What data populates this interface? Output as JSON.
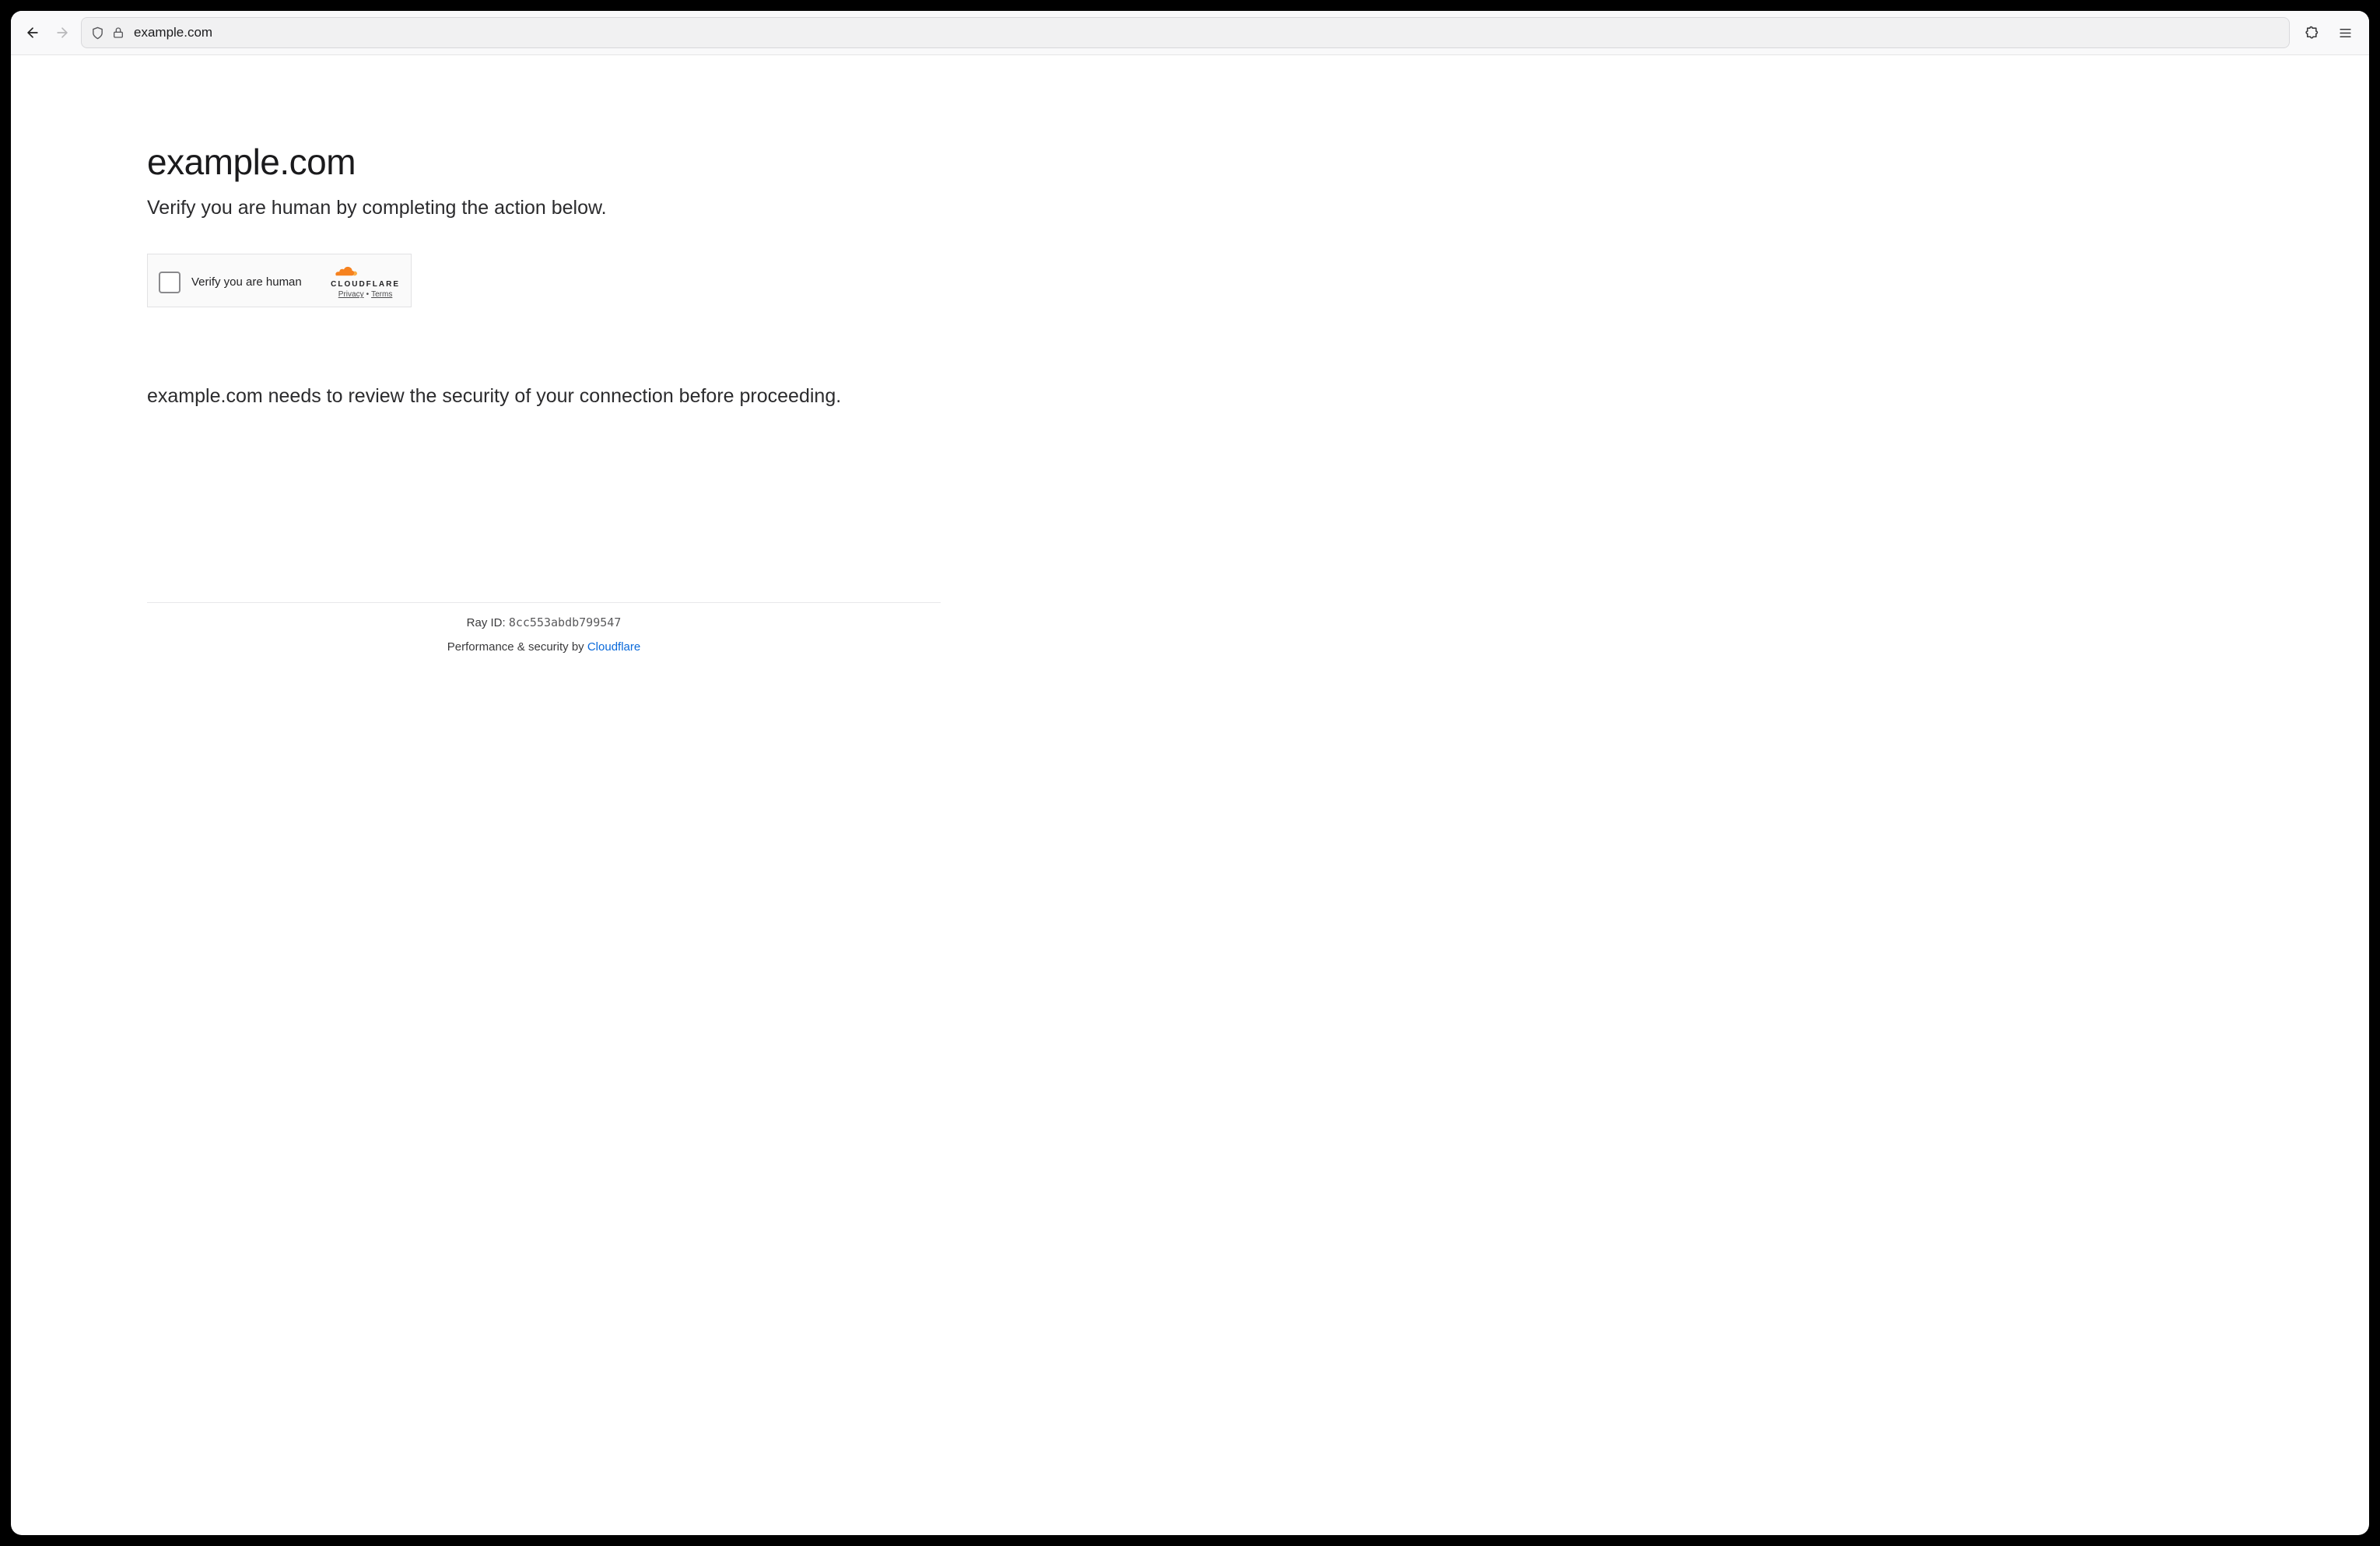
{
  "browser": {
    "url": "example.com"
  },
  "page": {
    "site_title": "example.com",
    "subtitle": "Verify you are human by completing the action below.",
    "message": "example.com needs to review the security of your connection before proceeding."
  },
  "captcha": {
    "label": "Verify you are human",
    "brand": "CLOUDFLARE",
    "privacy": "Privacy",
    "terms": "Terms"
  },
  "footer": {
    "ray_label": "Ray ID: ",
    "ray_id": "8cc553abdb799547",
    "perf_prefix": "Performance & security by ",
    "perf_link": "Cloudflare"
  }
}
